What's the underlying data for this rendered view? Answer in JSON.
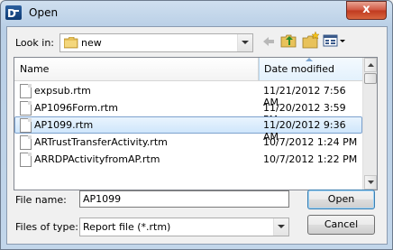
{
  "window": {
    "title": "Open",
    "close_label": "x"
  },
  "look_in": {
    "label": "Look in:",
    "value": "new"
  },
  "toolbar_icons": [
    "back-arrow-icon",
    "up-folder-icon",
    "new-folder-icon",
    "view-menu-icon"
  ],
  "file_list": {
    "columns": [
      "Name",
      "Date modified"
    ],
    "rows": [
      {
        "name": "expsub.rtm",
        "date": "11/21/2012 7:56 AM",
        "selected": false
      },
      {
        "name": "AP1096Form.rtm",
        "date": "11/20/2012 3:59 PM",
        "selected": false
      },
      {
        "name": "AP1099.rtm",
        "date": "11/20/2012 9:36 AM",
        "selected": true
      },
      {
        "name": "ARTrustTransferActivity.rtm",
        "date": "10/7/2012 1:24 PM",
        "selected": false
      },
      {
        "name": "ARRDPActivityfromAP.rtm",
        "date": "10/7/2012 1:22 PM",
        "selected": false
      }
    ]
  },
  "file_name": {
    "label": "File name:",
    "value": "AP1099"
  },
  "file_type": {
    "label": "Files of type:",
    "value": "Report file (*.rtm)"
  },
  "buttons": {
    "open": "Open",
    "cancel": "Cancel"
  },
  "colors": {
    "title_bar": "#c2d6ea",
    "close_button": "#c0391f",
    "selection": "#cfe6fb",
    "folder": "#e8c25a"
  }
}
